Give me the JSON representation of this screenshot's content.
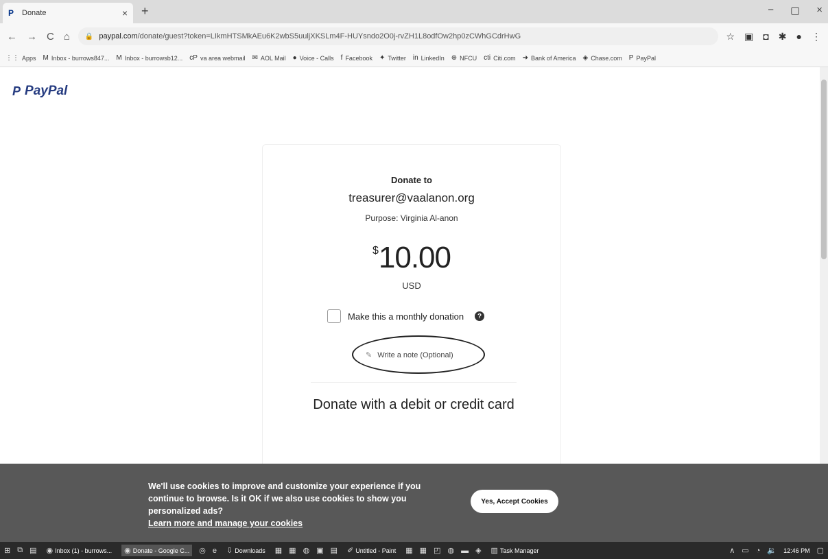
{
  "browser": {
    "tab_title": "Donate",
    "tab_close": "×",
    "new_tab": "+",
    "window_controls": [
      "−",
      "▢",
      "×"
    ],
    "url_host": "paypal.com",
    "url_path": "/donate/guest?token=LIkmHTSMkAEu6K2wbS5uuljXKSLm4F-HUYsndo2O0j-rvZH1L8odfOw2hp0zCWhGCdrHwG",
    "bookmarks": [
      {
        "icon": "apps-icon",
        "glyph": "⋮⋮",
        "label": "Apps"
      },
      {
        "icon": "gmail-icon",
        "glyph": "M",
        "label": "Inbox - burrows847..."
      },
      {
        "icon": "gmail-icon",
        "glyph": "M",
        "label": "Inbox - burrowsb12..."
      },
      {
        "icon": "webmail-icon",
        "glyph": "cP",
        "label": "va area webmail"
      },
      {
        "icon": "aol-icon",
        "glyph": "✉",
        "label": "AOL Mail"
      },
      {
        "icon": "voice-icon",
        "glyph": "●",
        "label": "Voice - Calls"
      },
      {
        "icon": "facebook-icon",
        "glyph": "f",
        "label": "Facebook"
      },
      {
        "icon": "twitter-icon",
        "glyph": "✦",
        "label": "Twitter"
      },
      {
        "icon": "linkedin-icon",
        "glyph": "in",
        "label": "LinkedIn"
      },
      {
        "icon": "globe-icon",
        "glyph": "⊕",
        "label": "NFCU"
      },
      {
        "icon": "citi-icon",
        "glyph": "cti",
        "label": "Citi.com"
      },
      {
        "icon": "bofa-icon",
        "glyph": "➜",
        "label": "Bank of America"
      },
      {
        "icon": "chase-icon",
        "glyph": "◈",
        "label": "Chase.com"
      },
      {
        "icon": "paypal-icon",
        "glyph": "P",
        "label": "PayPal"
      }
    ]
  },
  "page": {
    "logo_text": "PayPal",
    "donate_to": "Donate to",
    "email": "treasurer@vaalanon.org",
    "purpose": "Purpose: Virginia Al-anon",
    "currency_symbol": "$",
    "amount": "10.00",
    "currency_code": "USD",
    "monthly_label": "Make this a monthly donation",
    "help_glyph": "?",
    "note_label": "Write a note (Optional)",
    "card_heading": "Donate with a debit or credit card"
  },
  "cookie_banner": {
    "message": "We'll use cookies to improve and customize your experience if you continue to browse. Is it OK if we also use cookies to show you personalized ads?",
    "link": "Learn more and manage your cookies",
    "accept_button": "Yes, Accept Cookies"
  },
  "taskbar": {
    "items": [
      {
        "label": "Inbox (1) - burrows...",
        "active": false
      },
      {
        "label": "Donate - Google C...",
        "active": true
      },
      {
        "label": "Downloads",
        "active": false
      },
      {
        "label": "Untitled - Paint",
        "active": false
      },
      {
        "label": "Task Manager",
        "active": false
      }
    ],
    "clock": "12:46 PM"
  }
}
